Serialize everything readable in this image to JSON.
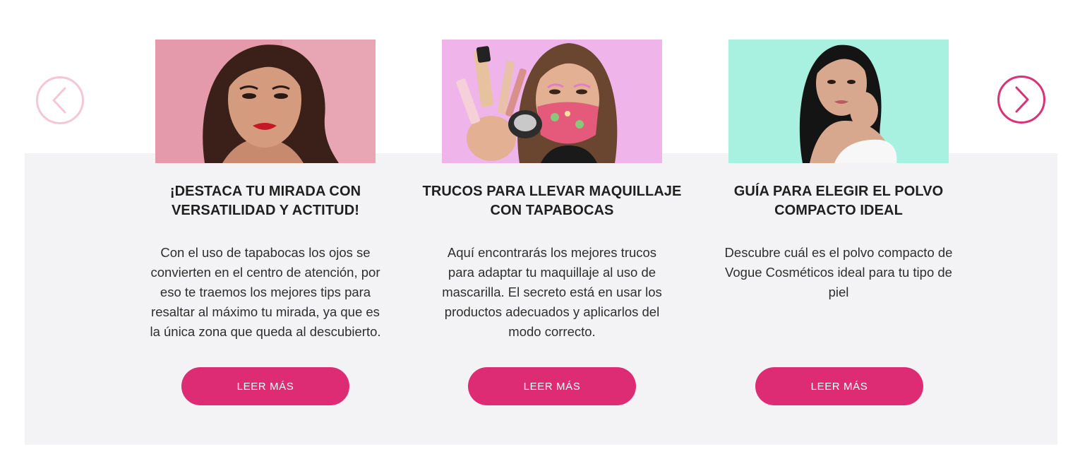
{
  "carousel": {
    "prev_icon": "chevron-left-icon",
    "next_icon": "chevron-right-icon",
    "colors": {
      "prev_border": "#f4c7d8",
      "next_border": "#d93277",
      "button_bg": "#dd2c74",
      "panel_bg": "#f3f3f5"
    }
  },
  "cards": [
    {
      "image_desc": "woman-portrait-pink-background",
      "title": "¡DESTACA TU MIRADA CON VERSATILIDAD Y ACTITUD!",
      "description": "Con el uso de tapabocas los ojos se convierten en el centro de atención, por eso te traemos los mejores tips para resaltar al máximo tu mirada, ya que es la única zona que queda al descubierto.",
      "button_label": "LEER MÁS"
    },
    {
      "image_desc": "woman-with-mask-holding-makeup",
      "title": "TRUCOS PARA LLEVAR MAQUILLAJE CON TAPABOCAS",
      "description": "Aquí encontrarás los mejores trucos para adaptar tu maquillaje al uso de mascarilla. El secreto está en usar los productos adecuados y aplicarlos del modo correcto.",
      "button_label": "LEER MÁS"
    },
    {
      "image_desc": "woman-portrait-mint-background",
      "title": "GUÍA PARA ELEGIR EL POLVO COMPACTO IDEAL",
      "description": "Descubre cuál es el polvo compacto de Vogue Cosméticos ideal para tu tipo de piel",
      "button_label": "LEER MÁS"
    }
  ]
}
